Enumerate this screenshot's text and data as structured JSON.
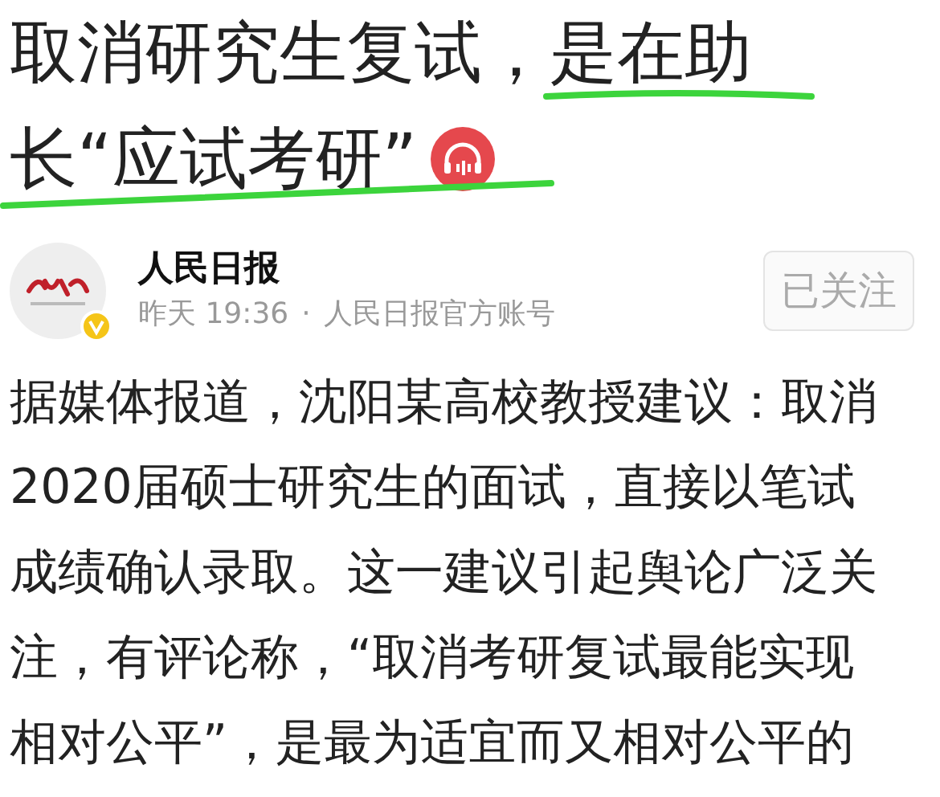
{
  "article": {
    "title_lines": [
      "取消研究生复试，是在助",
      "长“应试考研”"
    ],
    "audio": true
  },
  "author": {
    "name": "人民日报",
    "verified": true,
    "time": "昨天 19:36",
    "separator": "·",
    "source": "人民日报官方账号",
    "follow_button": "已关注",
    "followed": true
  },
  "body_lines": [
    "据媒体报道，沈阳某高校教授建议：取消",
    "2020届硕士研究生的面试，直接以笔试",
    "成绩确认录取。这一建议引起舆论广泛关",
    "注，有评论称，“取消考研复试最能实现",
    "相对公平”，是最为适宜而又相对公平的"
  ]
}
